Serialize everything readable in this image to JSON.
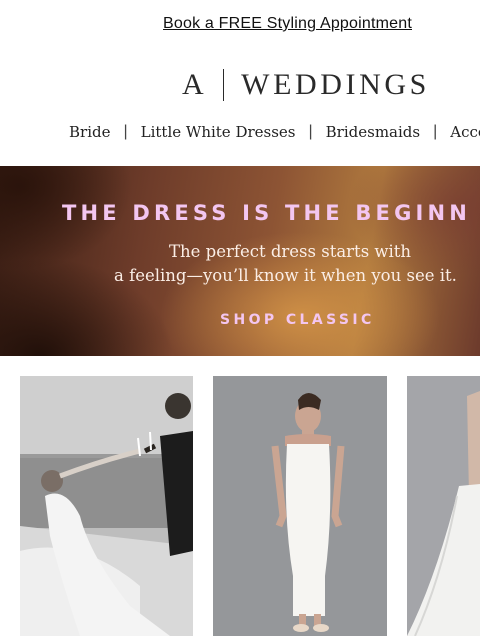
{
  "promo": {
    "link_text": "Book a FREE Styling Appointment"
  },
  "logo": {
    "mark": "A",
    "wordmark": "WEDDINGS"
  },
  "nav": {
    "items": [
      {
        "label": "Bride"
      },
      {
        "label": "Little White Dresses"
      },
      {
        "label": "Bridesmaids"
      },
      {
        "label": "Acces"
      }
    ],
    "separator": "|"
  },
  "hero": {
    "headline": "THE DRESS IS THE BEGINN",
    "subtitle_line1": "The perfect dress starts with",
    "subtitle_line2": "a feeling—you’ll know it when you see it.",
    "cta": "SHOP CLASSIC",
    "accent_color": "#f3c6f0"
  },
  "products": [
    {
      "image": "couple-on-boat-photo"
    },
    {
      "image": "white-midi-slip-dress-photo"
    },
    {
      "image": "white-ball-gown-photo"
    }
  ]
}
